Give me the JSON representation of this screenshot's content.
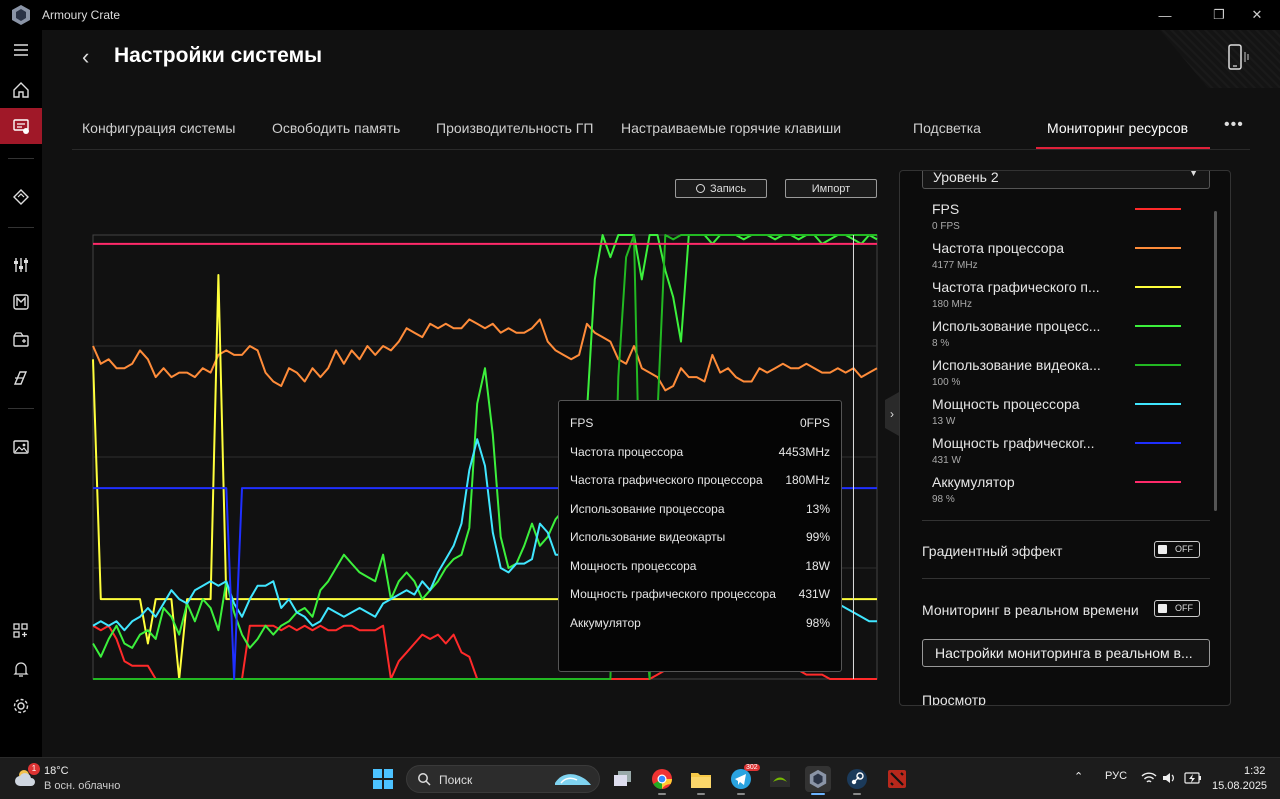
{
  "window": {
    "title": "Armoury Crate"
  },
  "page": {
    "title": "Настройки системы"
  },
  "tabs": [
    {
      "label": "Конфигурация системы"
    },
    {
      "label": "Освободить память"
    },
    {
      "label": "Производительность ГП"
    },
    {
      "label": "Настраиваемые горячие клавиши"
    },
    {
      "label": "Подсветка"
    },
    {
      "label": "Мониторинг ресурсов",
      "active": true
    }
  ],
  "toolbar": {
    "record_label": "Запись",
    "import_label": "Импорт"
  },
  "chart_data": {
    "type": "line",
    "title": "",
    "xlabel": "",
    "ylabel": "",
    "ylim": [
      0,
      100
    ],
    "grid": true,
    "x": [
      0,
      1,
      2,
      3,
      4,
      5,
      6,
      7,
      8,
      9,
      10,
      11,
      12,
      13,
      14,
      15,
      16,
      17,
      18,
      19,
      20,
      21,
      22,
      23,
      24,
      25,
      26,
      27,
      28,
      29,
      30,
      31,
      32,
      33,
      34,
      35,
      36,
      37,
      38,
      39,
      40,
      41,
      42,
      43,
      44,
      45,
      46,
      47,
      48,
      49,
      50,
      51,
      52,
      53,
      54,
      55,
      56,
      57,
      58,
      59,
      60,
      61,
      62,
      63,
      64,
      65,
      66,
      67,
      68,
      69,
      70,
      71,
      72,
      73,
      74,
      75,
      76,
      77,
      78,
      79,
      80,
      81,
      82,
      83,
      84,
      85,
      86,
      87,
      88,
      89,
      90,
      91,
      92,
      93,
      94,
      95,
      96,
      97,
      98,
      99,
      100
    ],
    "series": [
      {
        "name": "FPS",
        "color": "#ff2a2a",
        "values": [
          12,
          11,
          12,
          9,
          4,
          3,
          3,
          3,
          0,
          0,
          0,
          0,
          0,
          0,
          0,
          0,
          0,
          0,
          0,
          0,
          12,
          12,
          12,
          12,
          11,
          12,
          11,
          12,
          11,
          12,
          11,
          11,
          12,
          12,
          11,
          11,
          11,
          12,
          0,
          4,
          6,
          8,
          10,
          9,
          10,
          8,
          10,
          6,
          5,
          0,
          0,
          0,
          0,
          0,
          0,
          0,
          0,
          0,
          0,
          0,
          0,
          0,
          0,
          0,
          0,
          0,
          0,
          0,
          0,
          0,
          0,
          0,
          1,
          2,
          3,
          4,
          5,
          6,
          7,
          6,
          7,
          5,
          6,
          4,
          6,
          5,
          4,
          5,
          3,
          2,
          2,
          1,
          1,
          1,
          0,
          0,
          0,
          0,
          0,
          0,
          0
        ]
      },
      {
        "name": "Частота процессора",
        "color": "#ff8c3a",
        "values": [
          75,
          71,
          72,
          70,
          70,
          71,
          74,
          72,
          68,
          70,
          68,
          69,
          69,
          68,
          70,
          69,
          73,
          74,
          73,
          73,
          75,
          74,
          69,
          67,
          66,
          70,
          69,
          67,
          70,
          68,
          70,
          74,
          71,
          74,
          72,
          75,
          73,
          75,
          74,
          76,
          79,
          78,
          77,
          80,
          79,
          80,
          79,
          79,
          81,
          80,
          79,
          80,
          78,
          79,
          78,
          78,
          79,
          81,
          76,
          74,
          73,
          72,
          73,
          80,
          78,
          77,
          76,
          72,
          71,
          75,
          70,
          69,
          68,
          65,
          66,
          70,
          68,
          68,
          67,
          73,
          69,
          70,
          68,
          67,
          67,
          70,
          69,
          70,
          71,
          70,
          70,
          71,
          70,
          69,
          69,
          70,
          69,
          70,
          68,
          69,
          70
        ]
      },
      {
        "name": "Частота графического процессора",
        "color": "#ffff3c",
        "values": [
          72,
          18,
          18,
          18,
          18,
          18,
          18,
          8,
          18,
          18,
          18,
          0,
          18,
          18,
          18,
          18,
          91,
          18,
          18,
          18,
          18,
          18,
          18,
          18,
          18,
          18,
          18,
          18,
          18,
          18,
          18,
          18,
          18,
          18,
          18,
          18,
          18,
          18,
          18,
          18,
          18,
          18,
          18,
          18,
          18,
          18,
          18,
          18,
          18,
          18,
          18,
          18,
          18,
          18,
          18,
          18,
          18,
          18,
          18,
          18,
          18,
          18,
          18,
          18,
          18,
          18,
          18,
          18,
          18,
          18,
          18,
          18,
          18,
          18,
          18,
          18,
          18,
          18,
          18,
          18,
          18,
          18,
          18,
          18,
          18,
          18,
          18,
          18,
          18,
          18,
          18,
          18,
          18,
          18,
          18,
          18,
          18,
          18,
          18,
          18,
          18
        ]
      },
      {
        "name": "Использование процессора",
        "color": "#3cf03c",
        "values": [
          8,
          5,
          9,
          12,
          8,
          7,
          10,
          11,
          9,
          16,
          14,
          10,
          17,
          13,
          18,
          16,
          11,
          22,
          15,
          10,
          7,
          9,
          12,
          10,
          12,
          13,
          15,
          16,
          14,
          20,
          22,
          25,
          28,
          26,
          24,
          23,
          22,
          28,
          18,
          22,
          24,
          22,
          18,
          20,
          22,
          25,
          27,
          28,
          34,
          62,
          70,
          55,
          32,
          25,
          26,
          30,
          35,
          30,
          32,
          36,
          38,
          40,
          45,
          60,
          90,
          100,
          95,
          100,
          100,
          100,
          90,
          100,
          100,
          92,
          86,
          76,
          100,
          100,
          100,
          98,
          100,
          100,
          100,
          99,
          100,
          100,
          100,
          99,
          100,
          100,
          99,
          100,
          100,
          98,
          99,
          100,
          100,
          99,
          98,
          100,
          99
        ]
      },
      {
        "name": "Использование видеокарты",
        "color": "#22b822",
        "values": [
          0,
          0,
          0,
          0,
          0,
          0,
          0,
          0,
          0,
          0,
          0,
          0,
          0,
          0,
          0,
          0,
          0,
          0,
          0,
          0,
          0,
          0,
          0,
          0,
          0,
          0,
          0,
          0,
          0,
          0,
          0,
          0,
          0,
          0,
          0,
          0,
          0,
          0,
          0,
          0,
          0,
          0,
          0,
          0,
          0,
          0,
          0,
          0,
          0,
          0,
          0,
          0,
          0,
          0,
          0,
          0,
          0,
          0,
          0,
          0,
          0,
          0,
          0,
          0,
          0,
          0,
          0,
          68,
          95,
          100,
          20,
          0,
          60,
          100,
          99,
          100,
          100,
          100,
          100,
          100,
          100,
          100,
          100,
          100,
          100,
          100,
          100,
          100,
          100,
          100,
          100,
          100,
          100,
          100,
          100,
          100,
          100,
          100,
          100,
          100,
          100
        ]
      },
      {
        "name": "Мощность процессора",
        "color": "#40e6ff",
        "values": [
          12,
          13,
          12,
          13,
          11,
          13,
          14,
          16,
          14,
          17,
          20,
          18,
          17,
          20,
          21,
          22,
          21,
          22,
          17,
          14,
          18,
          21,
          21,
          22,
          16,
          18,
          15,
          14,
          12,
          13,
          16,
          15,
          14,
          15,
          16,
          15,
          14,
          17,
          18,
          19,
          20,
          19,
          22,
          20,
          24,
          27,
          30,
          35,
          47,
          54,
          48,
          33,
          25,
          24,
          26,
          26,
          27,
          35,
          33,
          28,
          28,
          28,
          28,
          30,
          26,
          24,
          25,
          20,
          28,
          29,
          26,
          25,
          22,
          22,
          24,
          23,
          22,
          22,
          21,
          21,
          20,
          19,
          18,
          17,
          16,
          17,
          16,
          17,
          16,
          17,
          16,
          15,
          16,
          15,
          16,
          17,
          16,
          15,
          14,
          13,
          13
        ]
      },
      {
        "name": "Мощность графического процессора",
        "color": "#1f2fff",
        "values": [
          43,
          43,
          43,
          43,
          43,
          43,
          43,
          43,
          43,
          43,
          43,
          43,
          43,
          43,
          43,
          43,
          43,
          43,
          0,
          43,
          43,
          43,
          43,
          43,
          43,
          43,
          43,
          43,
          43,
          43,
          43,
          43,
          43,
          43,
          43,
          43,
          43,
          43,
          43,
          43,
          43,
          43,
          43,
          43,
          43,
          43,
          43,
          43,
          43,
          43,
          43,
          43,
          43,
          43,
          43,
          43,
          43,
          43,
          43,
          43,
          43,
          43,
          43,
          43,
          43,
          43,
          43,
          43,
          43,
          43,
          43,
          43,
          43,
          43,
          43,
          43,
          43,
          43,
          43,
          43,
          43,
          43,
          43,
          43,
          43,
          43,
          43,
          43,
          43,
          43,
          43,
          43,
          43,
          43,
          43,
          43,
          43,
          43,
          43,
          43,
          43
        ]
      },
      {
        "name": "Аккумулятор",
        "color": "#ff2a6a",
        "values": [
          98,
          98,
          98,
          98,
          98,
          98,
          98,
          98,
          98,
          98,
          98,
          98,
          98,
          98,
          98,
          98,
          98,
          98,
          98,
          98,
          98,
          98,
          98,
          98,
          98,
          98,
          98,
          98,
          98,
          98,
          98,
          98,
          98,
          98,
          98,
          98,
          98,
          98,
          98,
          98,
          98,
          98,
          98,
          98,
          98,
          98,
          98,
          98,
          98,
          98,
          98,
          98,
          98,
          98,
          98,
          98,
          98,
          98,
          98,
          98,
          98,
          98,
          98,
          98,
          98,
          98,
          98,
          98,
          98,
          98,
          98,
          98,
          98,
          98,
          98,
          98,
          98,
          98,
          98,
          98,
          98,
          98,
          98,
          98,
          98,
          98,
          98,
          98,
          98,
          98,
          98,
          98,
          98,
          98,
          98,
          98,
          98,
          98,
          98,
          98,
          98
        ]
      }
    ]
  },
  "tooltip": {
    "rows": [
      {
        "label": "FPS",
        "value": "0FPS"
      },
      {
        "label": "Частота процессора",
        "value": "4453MHz"
      },
      {
        "label": "Частота графического процессора",
        "value": "180MHz"
      },
      {
        "label": "Использование процессора",
        "value": "13%"
      },
      {
        "label": "Использование видеокарты",
        "value": "99%"
      },
      {
        "label": "Мощность процессора",
        "value": "18W"
      },
      {
        "label": "Мощность графического процессора",
        "value": "431W"
      },
      {
        "label": "Аккумулятор",
        "value": "98%"
      }
    ]
  },
  "panel": {
    "level": "Уровень 2",
    "metrics": [
      {
        "name": "FPS",
        "value": "0 FPS",
        "color": "#ff2a2a"
      },
      {
        "name": "Частота процессора",
        "value": "4177 MHz",
        "color": "#ff8c3a"
      },
      {
        "name": "Частота графического п...",
        "value": "180 MHz",
        "color": "#ffff3c"
      },
      {
        "name": "Использование процесс...",
        "value": "8 %",
        "color": "#3cf03c"
      },
      {
        "name": "Использование видеока...",
        "value": "100 %",
        "color": "#22b822"
      },
      {
        "name": "Мощность процессора",
        "value": "13 W",
        "color": "#40e6ff"
      },
      {
        "name": "Мощность графическог...",
        "value": "431 W",
        "color": "#1f2fff"
      },
      {
        "name": "Аккумулятор",
        "value": "98 %",
        "color": "#ff2a6a"
      }
    ],
    "gradient_label": "Градиентный эффект",
    "gradient_state": "OFF",
    "realtime_label": "Мониторинг в реальном времени",
    "realtime_state": "OFF",
    "realtime_settings_label": "Настройки мониторинга в реальном в...",
    "view_label": "Просмотр"
  },
  "taskbar": {
    "weather_temp": "18°C",
    "weather_desc": "В осн. облачно",
    "weather_badge": "1",
    "search_label": "Поиск",
    "telegram_badge": "302",
    "lang": "РУС",
    "time": "1:32",
    "date": "15.08.2025"
  }
}
